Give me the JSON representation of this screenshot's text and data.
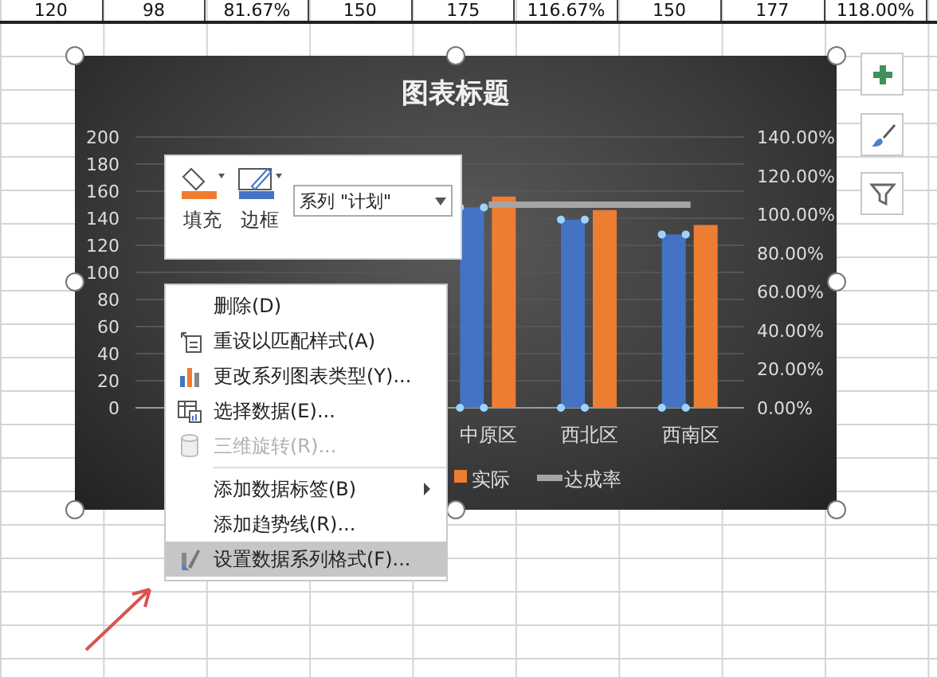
{
  "sheet": {
    "top_row": [
      "120",
      "98",
      "81.67%",
      "150",
      "175",
      "116.67%",
      "150",
      "177",
      "118.00%"
    ]
  },
  "chart": {
    "chart_data": {
      "type": "bar",
      "title": "图表标题",
      "categories": [
        null,
        null,
        null,
        "中原区",
        "西北区",
        "西南区"
      ],
      "series": [
        {
          "color": "#4472c4",
          "values": [
            null,
            null,
            null,
            148,
            139,
            128
          ]
        },
        {
          "name": "实际",
          "color": "#ed7d31",
          "values": [
            null,
            null,
            null,
            156,
            146,
            135
          ]
        },
        {
          "name": "达成率",
          "color": "#a5a5a5",
          "type": "line",
          "axis": "y2",
          "values": [
            null,
            null,
            null,
            105,
            105,
            105
          ]
        }
      ],
      "grid": true,
      "ylim": [
        0,
        200
      ],
      "yticks": [
        0,
        20,
        40,
        60,
        80,
        100,
        120,
        140,
        160,
        180,
        200
      ],
      "y2lim": [
        0,
        140
      ],
      "y2ticks": [
        {
          "value": 0,
          "label": "0.00%"
        },
        {
          "value": 20,
          "label": "20.00%"
        },
        {
          "value": 40,
          "label": "40.00%"
        },
        {
          "value": 60,
          "label": "60.00%"
        },
        {
          "value": 80,
          "label": "80.00%"
        },
        {
          "value": 100,
          "label": "100.00%"
        },
        {
          "value": 120,
          "label": "120.00%"
        },
        {
          "value": 140,
          "label": "140.00%"
        }
      ],
      "legend": true
    },
    "series_selected": [
      true,
      false
    ]
  },
  "toolbar": {
    "fill_label": "填充",
    "border_label": "边框",
    "series_dropdown": "系列 \"计划\""
  },
  "menu": {
    "groups": [
      {
        "items": [
          {
            "label": "删除(D)",
            "kind": "none",
            "disabled": false,
            "selected": false,
            "submenu": false
          },
          {
            "label": "重设以匹配样式(A)",
            "kind": "reset",
            "disabled": false,
            "selected": false,
            "submenu": false
          },
          {
            "label": "更改系列图表类型(Y)...",
            "kind": "chart",
            "disabled": false,
            "selected": false,
            "submenu": false
          },
          {
            "label": "选择数据(E)...",
            "kind": "data",
            "disabled": false,
            "selected": false,
            "submenu": false
          },
          {
            "label": "三维旋转(R)...",
            "kind": "cube",
            "disabled": true,
            "selected": false,
            "submenu": false
          }
        ]
      },
      {
        "items": [
          {
            "label": "添加数据标签(B)",
            "kind": "none",
            "disabled": false,
            "selected": false,
            "submenu": true
          },
          {
            "label": "添加趋势线(R)...",
            "kind": "none",
            "disabled": false,
            "selected": false,
            "submenu": false
          },
          {
            "label": "设置数据系列格式(F)...",
            "kind": "format",
            "disabled": false,
            "selected": true,
            "submenu": false
          }
        ]
      }
    ]
  }
}
